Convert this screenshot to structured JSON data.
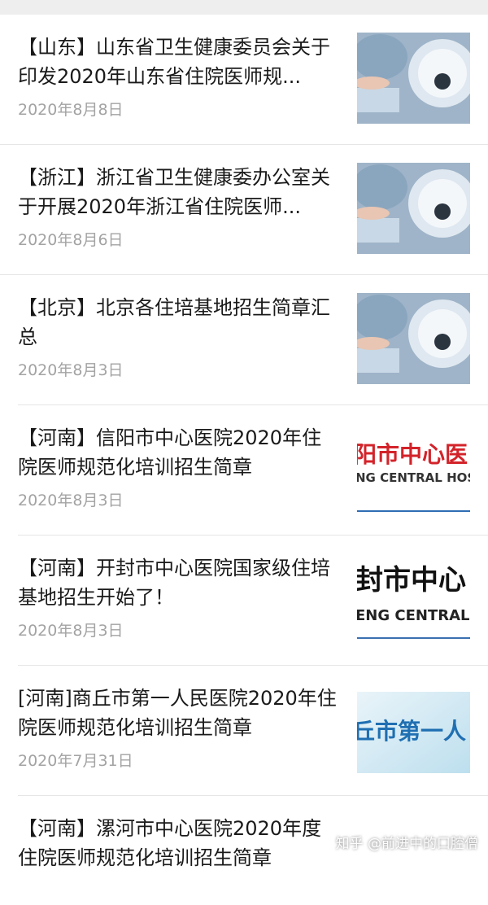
{
  "articles": [
    {
      "title": "【山东】山东省卫生健康委员会关于印发2020年山东省住院医师规...",
      "date": "2020年8月8日",
      "thumb": "surgeon-icon"
    },
    {
      "title": "【浙江】浙江省卫生健康委办公室关于开展2020年浙江省住院医师...",
      "date": "2020年8月6日",
      "thumb": "surgeon-icon"
    },
    {
      "title": "【北京】北京各住培基地招生简章汇总",
      "date": "2020年8月3日",
      "thumb": "surgeon-icon"
    },
    {
      "title": "【河南】信阳市中心医院2020年住院医师规范化培训招生简章",
      "date": "2020年8月3日",
      "thumb": "hospital-logo",
      "logo_cn": "阳市中心医",
      "logo_en": "NG CENTRAL HOS"
    },
    {
      "title": "【河南】开封市中心医院国家级住培基地招生开始了！",
      "date": "2020年8月3日",
      "thumb": "hospital-logo",
      "logo_cn": "封市中心",
      "logo_en": "ENG CENTRAL"
    },
    {
      "title": "[河南]商丘市第一人民医院2020年住院医师规范化培训招生简章",
      "date": "2020年7月31日",
      "thumb": "hospital-logo",
      "logo_cn": "丘市第一人"
    },
    {
      "title": "【河南】漯河市中心医院2020年度住院医师规范化培训招生简章"
    }
  ],
  "watermark": "知乎 @前进中的口腔僧"
}
